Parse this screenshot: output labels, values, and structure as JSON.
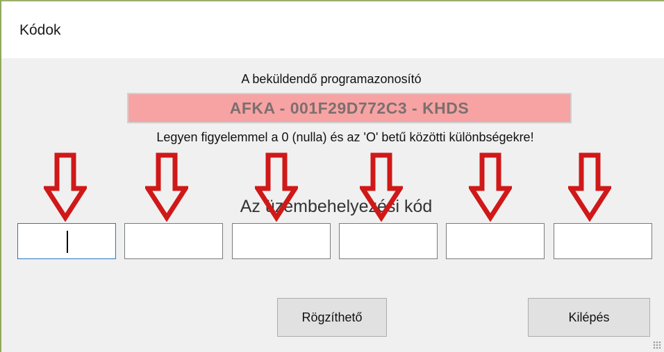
{
  "window": {
    "title": "Kódok"
  },
  "dialog": {
    "heading": "A beküldendő programazonosító",
    "program_id": "AFKA - 001F29D772C3 - KHDS",
    "warning": "Legyen figyelemmel a 0 (nulla) és az 'O' betű közötti különbségekre!",
    "code_label": "Az üzembehelyezési kód",
    "code_fields": [
      "",
      "",
      "",
      "",
      "",
      ""
    ],
    "buttons": {
      "save": "Rögzíthető",
      "exit": "Kilépés"
    }
  },
  "colors": {
    "program_id_bg": "#f7a3a3",
    "arrow_red": "#d01818",
    "focus_border": "#2a73c8"
  },
  "icons": {
    "arrow": "arrow-down-icon",
    "grip": "resize-grip-icon"
  }
}
